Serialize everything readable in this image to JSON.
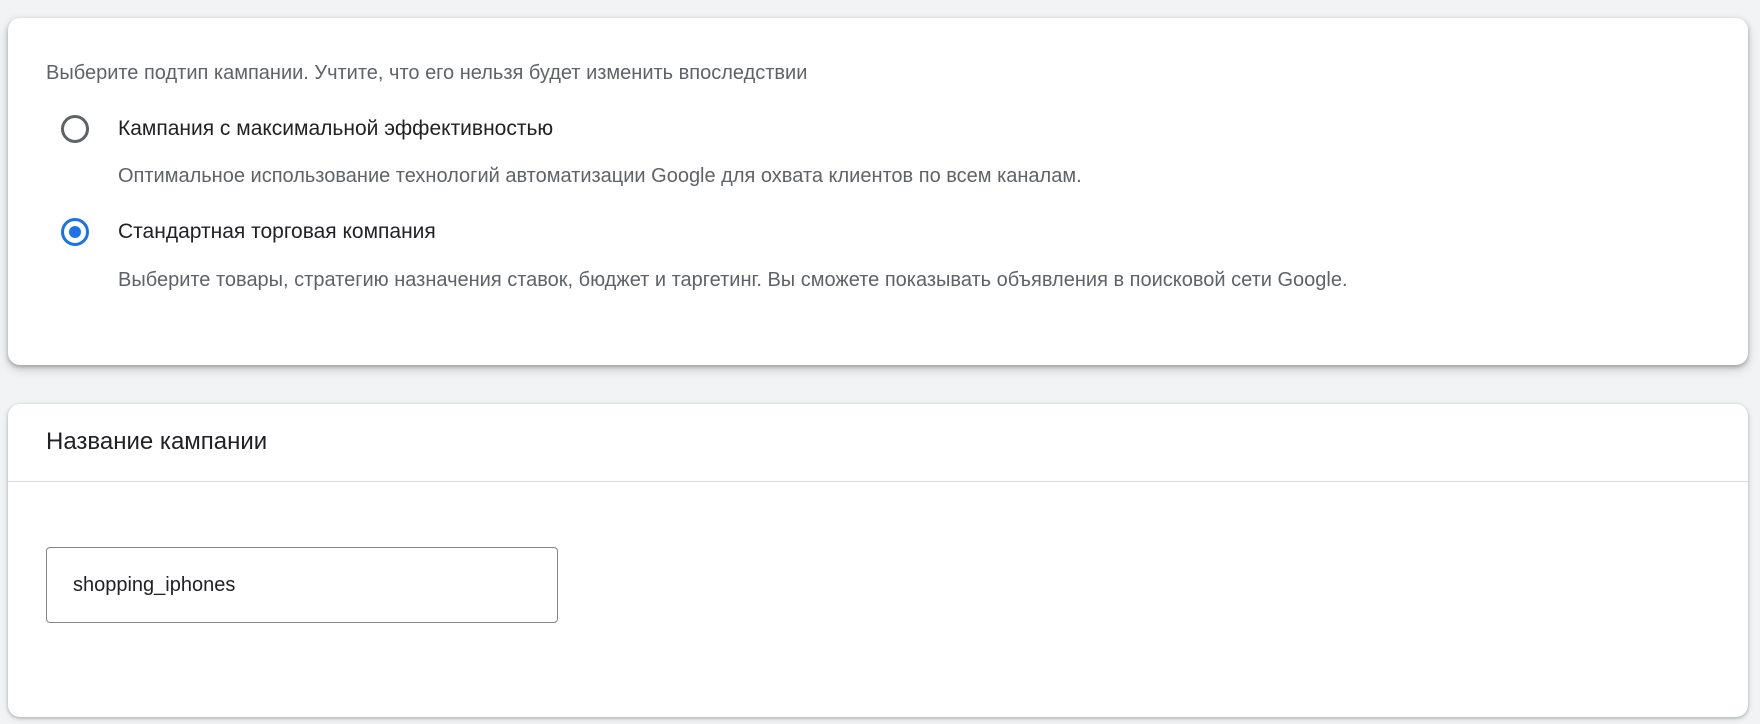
{
  "subtype_card": {
    "intro": "Выберите подтип кампании. Учтите, что его нельзя будет изменить впоследствии",
    "options": [
      {
        "label": "Кампания с максимальной эффективностью",
        "description": "Оптимальное использование технологий автоматизации Google для охвата клиентов по всем каналам.",
        "selected": false
      },
      {
        "label": "Стандартная торговая компания",
        "description": "Выберите товары, стратегию назначения ставок, бюджет и таргетинг. Вы сможете показывать объявления в поисковой сети Google.",
        "selected": true
      }
    ]
  },
  "name_card": {
    "title": "Название кампании",
    "input_value": "shopping_iphones"
  },
  "colors": {
    "accent": "#1a73e8",
    "background": "#f1f3f4",
    "text_primary": "#202124",
    "text_secondary": "#5f6368"
  },
  "icons": {
    "unselected_radio": "radio-unchecked-icon",
    "selected_radio": "radio-checked-icon"
  }
}
